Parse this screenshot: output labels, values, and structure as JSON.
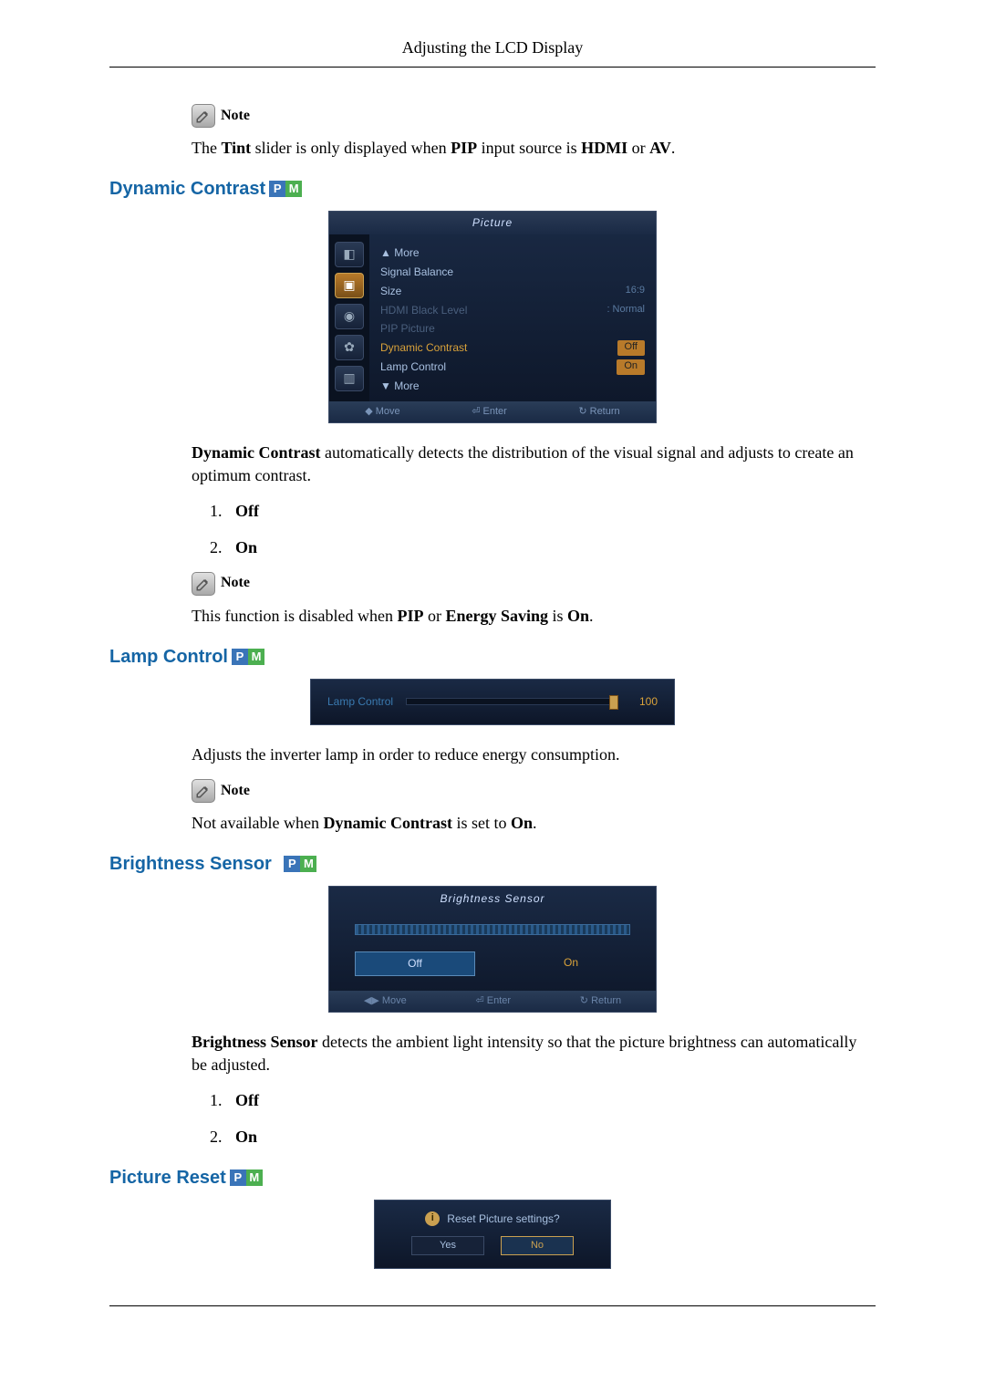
{
  "header": {
    "title": "Adjusting the LCD Display"
  },
  "pm": {
    "p": "P",
    "m": "M"
  },
  "note_label": "Note",
  "tint_note": {
    "pre": "The ",
    "b1": "Tint",
    "mid1": " slider is only displayed when ",
    "b2": "PIP",
    "mid2": " input source is ",
    "b3": "HDMI",
    "mid3": " or ",
    "b4": "AV",
    "post": "."
  },
  "dynamic_contrast": {
    "heading": "Dynamic Contrast",
    "desc_b": "Dynamic Contrast",
    "desc_rest": " automatically detects the distribution of the visual signal and adjusts to create an optimum contrast.",
    "list": [
      "Off",
      "On"
    ],
    "note": {
      "pre": "This function is disabled when ",
      "b1": "PIP",
      "mid1": " or ",
      "b2": "Energy Saving",
      "mid2": " is ",
      "b3": "On",
      "post": "."
    },
    "menu": {
      "title": "Picture",
      "more_up": "▲ More",
      "items": [
        {
          "label": "Signal Balance",
          "value": ""
        },
        {
          "label": "Size",
          "value": "16:9"
        },
        {
          "label": "HDMI Black Level",
          "value": ": Normal",
          "dim": true
        },
        {
          "label": "PIP Picture",
          "value": "",
          "dim": true
        },
        {
          "label": "Dynamic Contrast",
          "value": "Off",
          "hilite": true,
          "box": true
        },
        {
          "label": "Lamp Control",
          "value": "On",
          "box": true
        },
        {
          "label": "▼ More",
          "value": ""
        }
      ],
      "footer": {
        "move": "Move",
        "enter": "Enter",
        "return": "Return"
      }
    }
  },
  "lamp_control": {
    "heading": "Lamp Control",
    "slider": {
      "label": "Lamp Control",
      "value": "100"
    },
    "desc": "Adjusts the inverter lamp in order to reduce energy consumption.",
    "note": {
      "pre": "Not available when ",
      "b1": "Dynamic Contrast",
      "mid1": " is set to ",
      "b2": "On",
      "post": "."
    }
  },
  "brightness_sensor": {
    "heading": "Brightness Sensor",
    "menu": {
      "title": "Brightness Sensor",
      "off": "Off",
      "on": "On",
      "footer": {
        "move": "Move",
        "enter": "Enter",
        "return": "Return"
      }
    },
    "desc_b": "Brightness Sensor",
    "desc_rest": " detects the ambient light intensity so that the picture brightness can automatically be adjusted.",
    "list": [
      "Off",
      "On"
    ]
  },
  "picture_reset": {
    "heading": "Picture Reset",
    "dialog": {
      "msg": "Reset Picture settings?",
      "yes": "Yes",
      "no": "No"
    }
  }
}
